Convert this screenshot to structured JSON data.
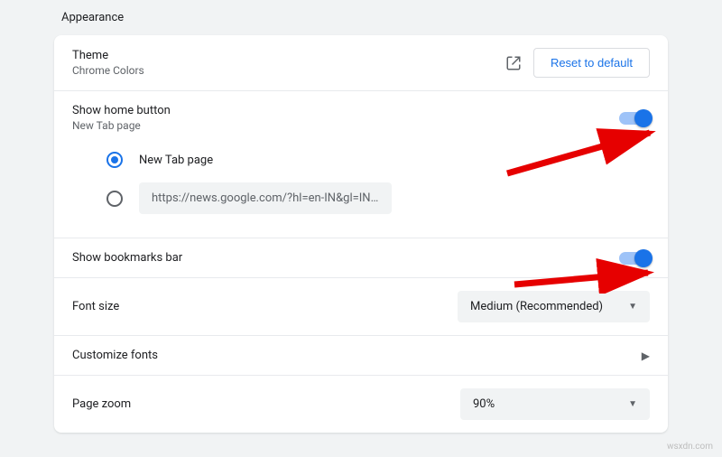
{
  "section": {
    "title": "Appearance"
  },
  "theme": {
    "title": "Theme",
    "sub": "Chrome Colors",
    "reset_label": "Reset to default"
  },
  "home": {
    "title": "Show home button",
    "sub": "New Tab page",
    "opt_newtab": "New Tab page",
    "opt_url": "https://news.google.com/?hl=en-IN&gl=IN&c…"
  },
  "bookmarks": {
    "title": "Show bookmarks bar"
  },
  "fontsize": {
    "title": "Font size",
    "value": "Medium (Recommended)"
  },
  "custfonts": {
    "title": "Customize fonts"
  },
  "zoom": {
    "title": "Page zoom",
    "value": "90%"
  },
  "watermark": "wsxdn.com"
}
